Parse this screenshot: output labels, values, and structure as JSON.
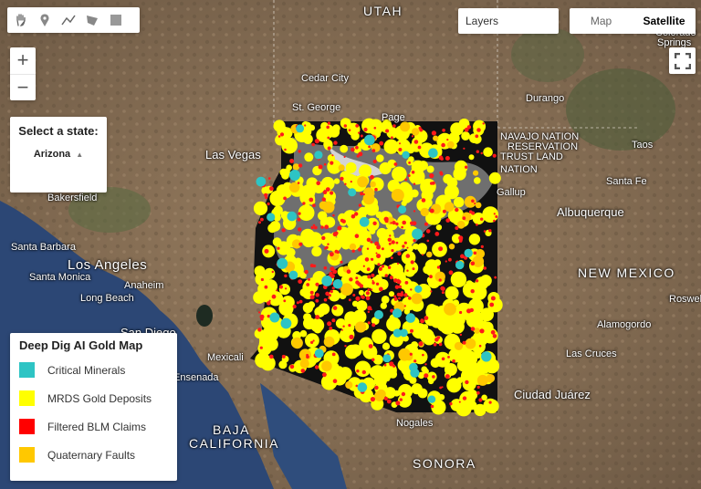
{
  "map": {
    "place_labels": {
      "utah": "UTAH",
      "cedar_city": "Cedar City",
      "st_george": "St. George",
      "page": "Page",
      "las_vegas": "Las Vegas",
      "california": "CALIFORNIA",
      "bakersfield": "Bakersfield",
      "santa_barbara": "Santa Barbara",
      "los_angeles": "Los Angeles",
      "santa_monica": "Santa Monica",
      "anaheim": "Anaheim",
      "long_beach": "Long Beach",
      "san_diego": "San Diego",
      "mexicali": "Mexicali",
      "ensenada": "Ensenada",
      "baja_california_1": "BAJA",
      "baja_california_2": "CALIFORNIA",
      "sonora": "SONORA",
      "nogales": "Nogales",
      "ciudad_juarez": "Ciudad Juárez",
      "las_cruces": "Las Cruces",
      "alamogordo": "Alamogordo",
      "new_mexico": "NEW MEXICO",
      "albuquerque": "Albuquerque",
      "santa_fe": "Santa Fe",
      "taos": "Taos",
      "durango": "Durango",
      "gallup": "Gallup",
      "navajo_1": "NAVAJO NATION",
      "navajo_2": "RESERVATION",
      "navajo_3": "TRUST LAND",
      "navajo_4": "NATION",
      "roswell": "Roswell",
      "colorado_springs_1": "Colorado",
      "colorado_springs_2": "Springs"
    },
    "overlay_state": "Arizona"
  },
  "toolbar": {
    "tools": [
      "hand-icon",
      "marker-icon",
      "line-icon",
      "polygon-icon",
      "rectangle-icon"
    ]
  },
  "layers_button": {
    "label": "Layers"
  },
  "map_type": {
    "map_label": "Map",
    "satellite_label": "Satellite",
    "active": "Satellite"
  },
  "zoom": {
    "in_label": "+",
    "out_label": "−"
  },
  "state_selector": {
    "title": "Select a state:",
    "selected": "Arizona"
  },
  "legend": {
    "title": "Deep Dig AI Gold Map",
    "items": [
      {
        "label": "Critical Minerals",
        "color": "#2ec4c4"
      },
      {
        "label": "MRDS Gold Deposits",
        "color": "#ffff00"
      },
      {
        "label": "Filtered BLM Claims",
        "color": "#ff0000"
      },
      {
        "label": "Quaternary Faults",
        "color": "#ffc800"
      }
    ]
  }
}
